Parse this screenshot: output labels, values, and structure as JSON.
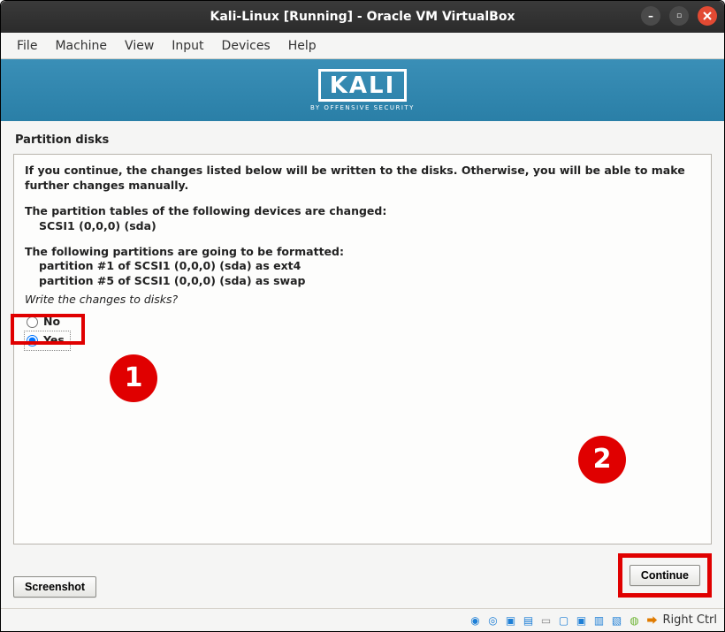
{
  "titlebar": {
    "title": "Kali-Linux [Running] - Oracle VM VirtualBox"
  },
  "menubar": {
    "items": [
      "File",
      "Machine",
      "View",
      "Input",
      "Devices",
      "Help"
    ]
  },
  "banner": {
    "logo_text": "KALI",
    "logo_sub": "BY OFFENSIVE SECURITY"
  },
  "installer": {
    "section_title": "Partition disks",
    "warning": "If you continue, the changes listed below will be written to the disks. Otherwise, you will be able to make further changes manually.",
    "tables_heading": "The partition tables of the following devices are changed:",
    "tables_item": "SCSI1 (0,0,0) (sda)",
    "format_heading": "The following partitions are going to be formatted:",
    "format_item1": "partition #1 of SCSI1 (0,0,0) (sda) as ext4",
    "format_item2": "partition #5 of SCSI1 (0,0,0) (sda) as swap",
    "question": "Write the changes to disks?",
    "option_no": "No",
    "option_yes": "Yes",
    "screenshot_btn": "Screenshot",
    "continue_btn": "Continue"
  },
  "callouts": {
    "c1": "1",
    "c2": "2"
  },
  "statusbar": {
    "host_key": "Right Ctrl"
  }
}
